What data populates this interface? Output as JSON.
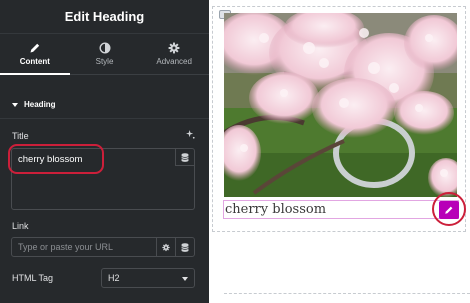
{
  "panel": {
    "title": "Edit Heading",
    "tabs": [
      {
        "label": "Content",
        "icon": "pencil-icon",
        "active": true
      },
      {
        "label": "Style",
        "icon": "half-circle-icon",
        "active": false
      },
      {
        "label": "Advanced",
        "icon": "gear-icon",
        "active": false
      }
    ],
    "section": {
      "label": "Heading",
      "icon": "caret-down-icon"
    },
    "title_field": {
      "label": "Title",
      "value": "cherry blossom",
      "ai_icon": "sparkle-icon",
      "dynamic_icon": "database-icon"
    },
    "link_field": {
      "label": "Link",
      "placeholder": "Type or paste your URL",
      "icons": [
        "gear-icon",
        "database-icon"
      ]
    },
    "html_tag": {
      "label": "HTML Tag",
      "value": "H2"
    },
    "collapse_icon": "chevron-left-icon"
  },
  "canvas": {
    "heading_text": "cherry blossom",
    "image": "cherry-blossom-photo",
    "edit_icon": "pencil-icon",
    "widget_handle_icon": "handle-icon"
  },
  "colors": {
    "panel_bg": "#26292c",
    "accent_magenta": "#b800b8",
    "highlight_red": "#cc1f3a",
    "heading_outline": "#e2a6e2"
  }
}
